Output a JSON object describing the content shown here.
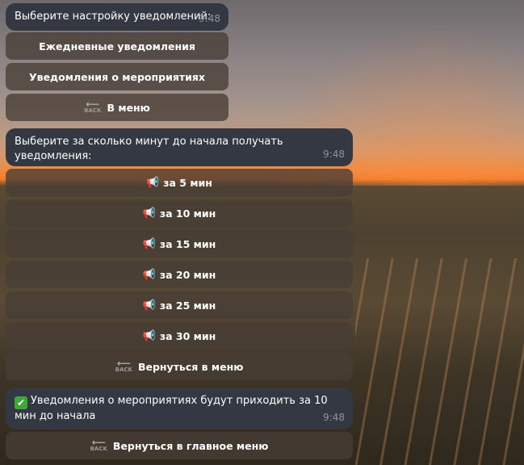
{
  "msg1": {
    "text": "Выберите настройку уведомлений:",
    "time": "9:48",
    "buttons": [
      "Ежедневные уведомления",
      "Уведомления о мероприятиях",
      "В меню"
    ]
  },
  "msg2": {
    "text": "Выберите за сколько минут до начала получать уведомления:",
    "time": "9:48",
    "buttons": [
      "за 5 мин",
      "за 10 мин",
      "за 15 мин",
      "за 20 мин",
      "за 25 мин",
      "за 30 мин",
      "Вернуться в меню"
    ]
  },
  "msg3": {
    "text": "Уведомления о мероприятиях будут приходить за 10 мин до начала",
    "time": "9:48",
    "buttons": [
      "Вернуться в главное меню"
    ]
  },
  "icons": {
    "megaphone": "📢",
    "back": "BACK",
    "check": "✔"
  }
}
